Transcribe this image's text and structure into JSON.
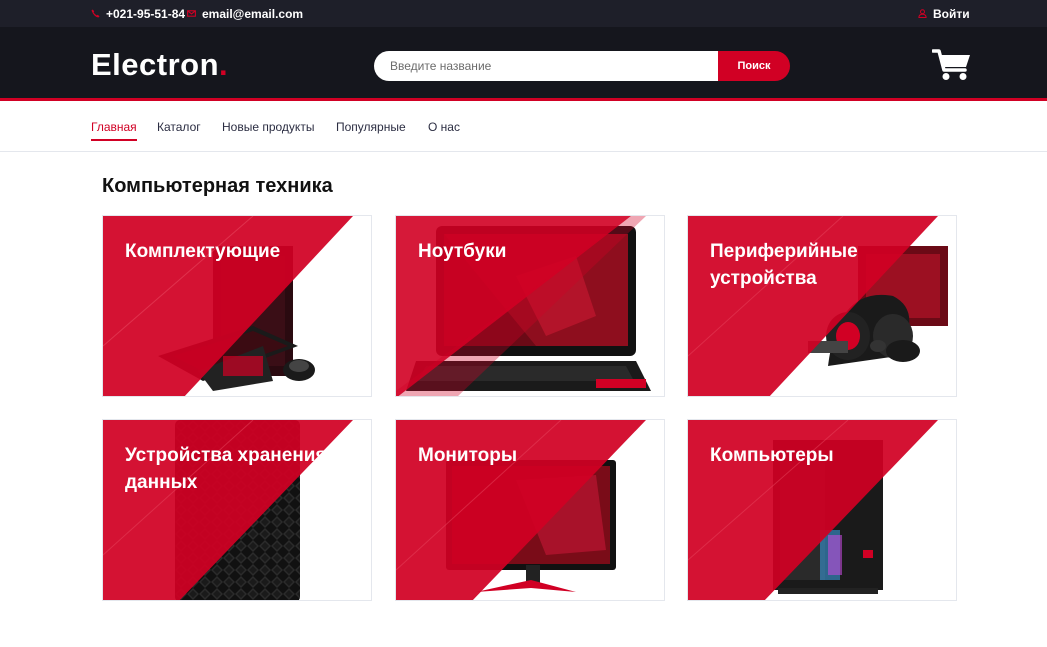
{
  "topbar": {
    "phone": "+021-95-51-84",
    "email": "email@email.com",
    "login": "Войти"
  },
  "header": {
    "logo_text": "Electron",
    "logo_dot": ".",
    "search_placeholder": "Введите название",
    "search_button": "Поиск",
    "cart_icon": "cart-icon"
  },
  "nav": {
    "items": [
      {
        "label": "Главная",
        "active": true
      },
      {
        "label": "Каталог",
        "active": false
      },
      {
        "label": "Новые продукты",
        "active": false
      },
      {
        "label": "Популярные",
        "active": false
      },
      {
        "label": "О нас",
        "active": false
      }
    ]
  },
  "section": {
    "title": "Компьютерная техника",
    "categories": [
      {
        "label": "Комплектующие",
        "image": "keyboard-mouse-pc"
      },
      {
        "label": "Ноутбуки",
        "image": "laptop"
      },
      {
        "label": "Периферийные устройства",
        "image": "headset-mouse"
      },
      {
        "label": "Устройства хранения данных",
        "image": "external-drive"
      },
      {
        "label": "Мониторы",
        "image": "monitor"
      },
      {
        "label": "Компьютеры",
        "image": "pc-case"
      }
    ]
  },
  "colors": {
    "accent": "#d10024",
    "header_bg": "#15161d",
    "topbar_bg": "#1e1f29"
  }
}
